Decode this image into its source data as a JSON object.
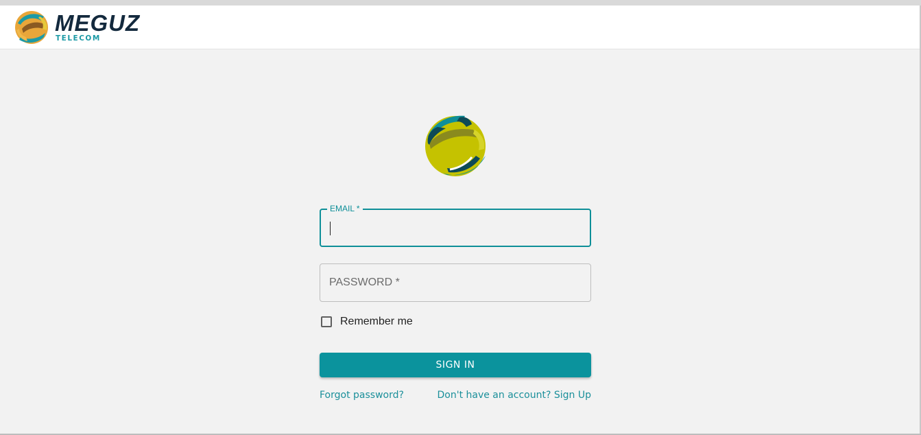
{
  "header": {
    "brand_name": "MEGUZ",
    "brand_sub": "TELECOM",
    "logo_icon": "globe-logo-icon"
  },
  "colors": {
    "accent": "#0b939d",
    "brand_dark": "#13293d",
    "link": "#1a8f9a",
    "background": "#f2f2f2"
  },
  "form": {
    "email_label": "EMAIL *",
    "email_value": "",
    "password_label": "PASSWORD *",
    "password_value": "",
    "remember_label": "Remember me",
    "remember_checked": false,
    "signin_label": "SIGN IN",
    "forgot_link": "Forgot password?",
    "signup_link": "Don't have an account? Sign Up"
  }
}
